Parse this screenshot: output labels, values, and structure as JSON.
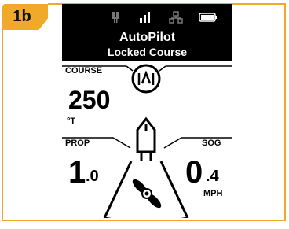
{
  "figure_label": "1b",
  "header": {
    "title": "AutoPilot",
    "subtitle": "Locked Course",
    "status_icons": [
      "remote-icon",
      "signal-bars-icon",
      "network-icon",
      "battery-icon"
    ]
  },
  "course": {
    "label": "COURSE",
    "value": "250",
    "unit": "°T",
    "mode_icon": "locked-course-icon"
  },
  "prop": {
    "label": "PROP",
    "value_int": "1",
    "value_dec": ".0"
  },
  "sog": {
    "label": "SOG",
    "value_int": "0",
    "value_dec": ".4",
    "unit": "MPH"
  },
  "colors": {
    "accent": "#f0a92b",
    "screen_bg": "#000000",
    "text": "#000000"
  }
}
